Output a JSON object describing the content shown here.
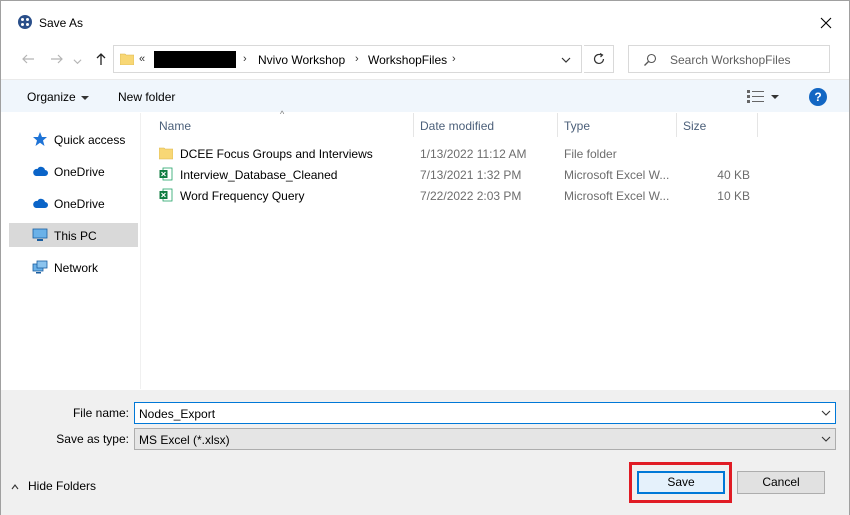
{
  "window": {
    "title": "Save As",
    "close_icon": "close-icon"
  },
  "nav": {
    "back_icon": "back-arrow-icon",
    "forward_icon": "forward-arrow-icon",
    "up_icon": "up-arrow-icon",
    "address": {
      "overflow": "«",
      "crumbs": [
        "Nvivo Workshop",
        "WorkshopFiles"
      ]
    },
    "search_placeholder": "Search WorkshopFiles"
  },
  "toolbar": {
    "organize_label": "Organize",
    "new_folder_label": "New folder",
    "help_label": "?"
  },
  "sidebar": {
    "items": [
      {
        "label": "Quick access",
        "icon": "star-icon"
      },
      {
        "label": "OneDrive",
        "icon": "cloud-icon"
      },
      {
        "label": "OneDrive",
        "icon": "cloud-icon"
      },
      {
        "label": "This PC",
        "icon": "computer-icon",
        "selected": true
      },
      {
        "label": "Network",
        "icon": "network-icon"
      }
    ]
  },
  "filelist": {
    "columns": [
      "Name",
      "Date modified",
      "Type",
      "Size"
    ],
    "rows": [
      {
        "name": "DCEE Focus Groups and Interviews",
        "date": "1/13/2022 11:12 AM",
        "type": "File folder",
        "size": "",
        "icon": "folder-icon"
      },
      {
        "name": "Interview_Database_Cleaned",
        "date": "7/13/2021 1:32 PM",
        "type": "Microsoft Excel W...",
        "size": "40 KB",
        "icon": "excel-file-icon"
      },
      {
        "name": "Word Frequency Query",
        "date": "7/22/2022 2:03 PM",
        "type": "Microsoft Excel W...",
        "size": "10 KB",
        "icon": "excel-file-icon"
      }
    ]
  },
  "form": {
    "file_name_label": "File name:",
    "file_name_value": "Nodes_Export",
    "save_as_type_label": "Save as type:",
    "save_as_type_value": "MS Excel (*.xlsx)",
    "hide_folders_label": "Hide Folders",
    "save_label": "Save",
    "cancel_label": "Cancel"
  },
  "colors": {
    "accent": "#0078d7",
    "highlight": "#e01b24",
    "toolbar_bg": "#f0f6fc"
  }
}
